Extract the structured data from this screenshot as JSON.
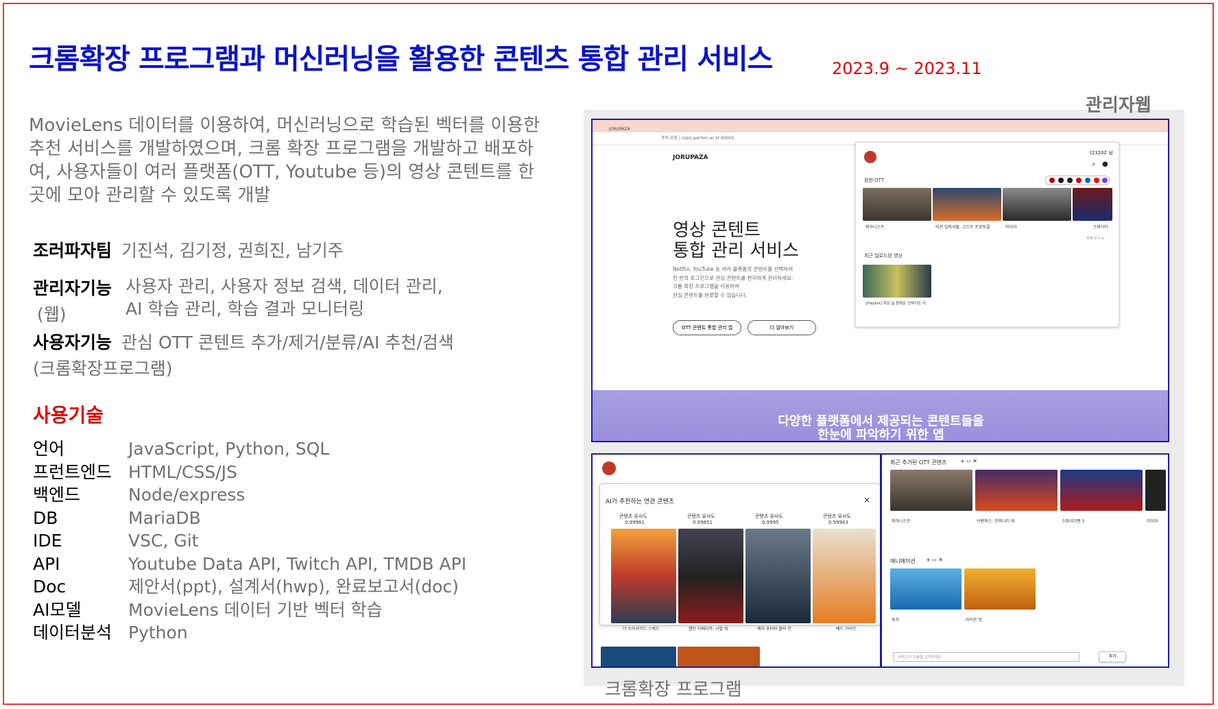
{
  "header": {
    "title": "크롬확장 프로그램과 머신러닝을 활용한 콘텐츠 통합 관리 서비스",
    "period": "2023.9 ~ 2023.11"
  },
  "description": {
    "line1": "MovieLens 데이터를 이용하여, 머신러닝으로 학습된 벡터를 이용한",
    "line2": "추천 서비스를 개발하였으며,  크롬 확장 프로그램을 개발하고 배포하",
    "line3": "여, 사용자들이 여러 플랫폼(OTT, Youtube 등)의 영상 콘텐트를 한",
    "line4": "곳에 모아 관리할 수 있도록 개발"
  },
  "team": {
    "label": "조러파자팀",
    "members": "기진석, 김기정, 권희진, 남기주"
  },
  "features": {
    "admin_label": "관리자기능",
    "admin_sub": "(웹)",
    "admin_line1": "사용자 관리, 사용자 정보 검색, 데이터 관리,",
    "admin_line2": "AI 학습 관리, 학습 결과 모니터링",
    "user_label": "사용자기능",
    "user_sub": "(크롬확장프로그램)",
    "user_line1": "관심 OTT 콘텐트 추가/제거/분류/AI 추천/검색"
  },
  "tech": {
    "title": "사용기술",
    "rows": [
      {
        "k": "언어",
        "v": "JavaScript, Python, SQL"
      },
      {
        "k": "프런트엔드",
        "v": "HTML/CSS/JS"
      },
      {
        "k": "백엔드",
        "v": "Node/express"
      },
      {
        "k": "DB",
        "v": "MariaDB"
      },
      {
        "k": "IDE",
        "v": "VSC, Git"
      },
      {
        "k": "API",
        "v": "Youtube Data API, Twitch API, TMDB API"
      },
      {
        "k": "Doc",
        "v": "제안서(ppt), 설계서(hwp), 완료보고서(doc)"
      },
      {
        "k": "AI모델",
        "v": "MovieLens 데이터 기반 벡터 학습"
      },
      {
        "k": "데이터분석",
        "v": "Python"
      }
    ]
  },
  "captions": {
    "admin_web": "관리자웹",
    "chrome_ext": "크롬확장 프로그램"
  },
  "admin_shot": {
    "tab": "JORUPAZA",
    "url": "주의 요함 | ceprj.gachon.ac.kr:60002",
    "brand": "JORUPAZA",
    "hero1": "영상 콘텐트",
    "hero2": "통합 관리 서비스",
    "hero_desc1": "Netflix, YouTube 등 여러 플랫폼의 콘텐트를 선택하여",
    "hero_desc2": "한 번의 로그인으로 관심 콘텐트를 편리하게 관리하세요.",
    "hero_desc3": "크롬 확장 프로그램을 이용하여",
    "hero_desc4": "관심 콘텐트를 분류할 수 있습니다.",
    "btn1": "OTT 콘텐트 통합 관리 앱",
    "btn2": "더 알아보기",
    "banner1": "다양한 플랫폼에서 제공되는 콘텐트들을",
    "banner2": "한눈에 파악하기 위한 앱",
    "popup_user": "t23202 님",
    "popup_ott": "원한 OTT",
    "popup_recent": "최근 업로드된 영상",
    "popup_more": "전체 보기 ≫",
    "movies": [
      "피아니스트",
      "미션 임파서블: 고스트 프로토콜",
      "미이라",
      "스파이더"
    ],
    "video": "[Playlist] 추운 날 창밖은 안쳐가도 이"
  },
  "ext_shot": {
    "modal_title": "AI가 추천하는 연관 콘텐츠",
    "sim_label": "콘텐츠 유사도",
    "recs": [
      {
        "score": "0.99981",
        "title": "더 수어사이드 스쿼드"
      },
      {
        "score": "0.99851",
        "title": "캡틴 아메리카: 시빌 워"
      },
      {
        "score": "0.9995",
        "title": "해리 포터와 불의 잔"
      },
      {
        "score": "0.99943",
        "title": "배드 가이즈"
      }
    ],
    "recent_title": "최근 추가된 OTT 콘텐츠",
    "recent_movies": [
      "피아니스트",
      "어벤져스: 인피니티 워",
      "스파이더맨 3",
      "미이라"
    ],
    "anim_title": "애니메이션",
    "anim_movies": [
      "루카",
      "라이온 킹"
    ],
    "input_placeholder": "카테고리 이름을 입력하세요",
    "add_btn": "추가"
  }
}
